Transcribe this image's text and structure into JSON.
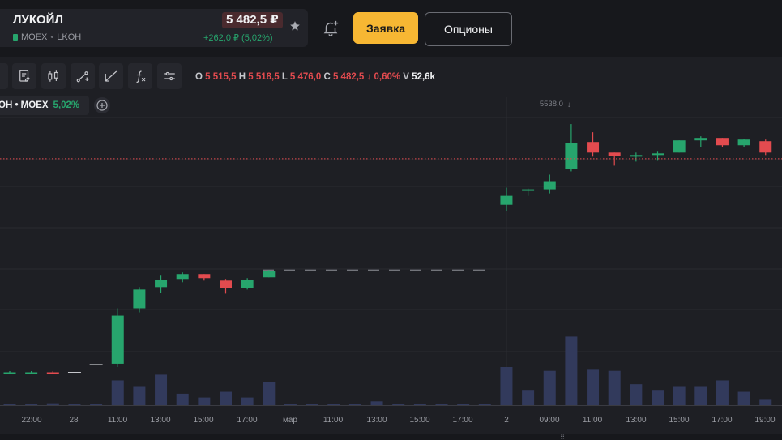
{
  "header": {
    "ticker_name": "ЛУКОЙЛ",
    "exchange": "MOEX",
    "symbol": "LKOH",
    "price": "5 482,5 ₽",
    "change": "+262,0 ₽ (5,02%)",
    "order_button": "Заявка",
    "options_button": "Опционы"
  },
  "toolbar": {
    "ohlc": {
      "o_label": "O",
      "o": "5 515,5",
      "h_label": "H",
      "h": "5 518,5",
      "l_label": "L",
      "l": "5 476,0",
      "c_label": "C",
      "c": "5 482,5",
      "change": "0,60%",
      "v_label": "V",
      "v": "52,6k"
    },
    "icons": [
      "bar-type-icon",
      "indicator-list-icon",
      "candlestick-icon",
      "draw-line-icon",
      "angle-tool-icon",
      "function-icon",
      "settings-sliders-icon"
    ]
  },
  "legend": {
    "symbol": "OH • MOEX",
    "change": "5,02%"
  },
  "colors": {
    "up": "#27a56d",
    "down": "#e34b4f",
    "volume": "#323a5c",
    "background": "#1e1f24"
  },
  "chart_data": {
    "type": "candlestick",
    "x_ticks": [
      "22:00",
      "28",
      "11:00",
      "13:00",
      "15:00",
      "17:00",
      "мар",
      "11:00",
      "13:00",
      "15:00",
      "17:00",
      "2",
      "09:00",
      "11:00",
      "13:00",
      "15:00",
      "17:00",
      "19:00"
    ],
    "max_label": "5538,0",
    "last_price": 5482.5,
    "candles": [
      {
        "o": 5220.5,
        "h": 5222,
        "l": 5219,
        "c": 5220.5,
        "v": 0.3
      },
      {
        "o": 5220.5,
        "h": 5222,
        "l": 5219,
        "c": 5220.5,
        "v": 0.3
      },
      {
        "o": 5220.5,
        "h": 5222,
        "l": 5218,
        "c": 5219.5,
        "v": 0.5
      },
      {
        "o": 5220.5,
        "h": 5221,
        "l": 5220,
        "c": 5220.5,
        "v": 0.2
      },
      {
        "o": 5230,
        "h": 5231,
        "l": 5230,
        "c": 5230,
        "v": 0.3
      },
      {
        "o": 5231,
        "h": 5299,
        "l": 5227,
        "c": 5290,
        "v": 6.5
      },
      {
        "o": 5299,
        "h": 5325,
        "l": 5294,
        "c": 5322,
        "v": 5
      },
      {
        "o": 5325,
        "h": 5340,
        "l": 5318,
        "c": 5334,
        "v": 8
      },
      {
        "o": 5335,
        "h": 5343,
        "l": 5331,
        "c": 5341,
        "v": 3
      },
      {
        "o": 5341,
        "h": 5341,
        "l": 5333,
        "c": 5336,
        "v": 2
      },
      {
        "o": 5333,
        "h": 5335,
        "l": 5317,
        "c": 5324,
        "v": 3.5
      },
      {
        "o": 5324,
        "h": 5336,
        "l": 5322,
        "c": 5334,
        "v": 2
      },
      {
        "o": 5337,
        "h": 5346,
        "l": 5337,
        "c": 5345,
        "v": 6
      },
      {
        "o": 5346,
        "h": 5346,
        "l": 5346,
        "c": 5346,
        "v": 0.4
      },
      {
        "o": 5346,
        "h": 5346,
        "l": 5346,
        "c": 5346,
        "v": 0.4
      },
      {
        "o": 5346,
        "h": 5346,
        "l": 5346,
        "c": 5346,
        "v": 0.4
      },
      {
        "o": 5346,
        "h": 5346,
        "l": 5346,
        "c": 5346,
        "v": 0.4
      },
      {
        "o": 5346,
        "h": 5346,
        "l": 5346,
        "c": 5346,
        "v": 1
      },
      {
        "o": 5346,
        "h": 5346,
        "l": 5346,
        "c": 5346,
        "v": 0.4
      },
      {
        "o": 5346,
        "h": 5346,
        "l": 5346,
        "c": 5346,
        "v": 0.4
      },
      {
        "o": 5346,
        "h": 5346,
        "l": 5346,
        "c": 5346,
        "v": 0.4
      },
      {
        "o": 5346,
        "h": 5346,
        "l": 5346,
        "c": 5346,
        "v": 0.4
      },
      {
        "o": 5346,
        "h": 5346,
        "l": 5346,
        "c": 5346,
        "v": 0.4
      },
      {
        "o": 5426,
        "h": 5447,
        "l": 5418,
        "c": 5437,
        "v": 10
      },
      {
        "o": 5443,
        "h": 5446,
        "l": 5437,
        "c": 5445,
        "v": 4
      },
      {
        "o": 5445,
        "h": 5463,
        "l": 5440,
        "c": 5455,
        "v": 9
      },
      {
        "o": 5470,
        "h": 5525,
        "l": 5467,
        "c": 5502,
        "v": 18
      },
      {
        "o": 5503,
        "h": 5515,
        "l": 5485,
        "c": 5490,
        "v": 9.5
      },
      {
        "o": 5490,
        "h": 5490,
        "l": 5474,
        "c": 5486,
        "v": 9
      },
      {
        "o": 5485,
        "h": 5490,
        "l": 5479,
        "c": 5487,
        "v": 5.5
      },
      {
        "o": 5487,
        "h": 5492,
        "l": 5480,
        "c": 5489,
        "v": 4
      },
      {
        "o": 5490,
        "h": 5505,
        "l": 5490,
        "c": 5505,
        "v": 5
      },
      {
        "o": 5505,
        "h": 5510,
        "l": 5497,
        "c": 5508,
        "v": 5
      },
      {
        "o": 5508,
        "h": 5508,
        "l": 5497,
        "c": 5499,
        "v": 6.5
      },
      {
        "o": 5499,
        "h": 5507,
        "l": 5497,
        "c": 5506,
        "v": 3.5
      },
      {
        "o": 5504,
        "h": 5506,
        "l": 5487,
        "c": 5490,
        "v": 1.4
      }
    ]
  }
}
